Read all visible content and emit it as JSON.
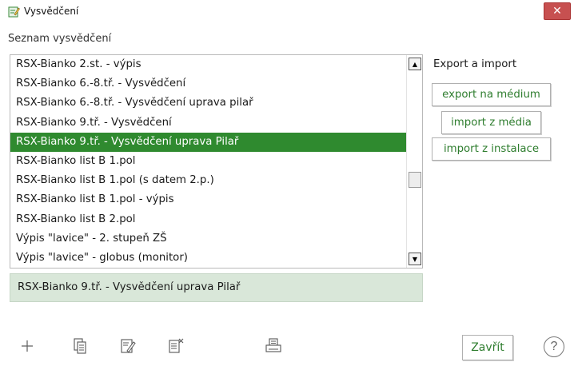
{
  "window": {
    "title": "Vysvědčení",
    "close_label": "✕"
  },
  "list": {
    "label": "Seznam vysvědčení",
    "items": [
      "RSX-Bianko 2.st. - výpis",
      "RSX-Bianko 6.-8.tř. - Vysvědčení",
      "RSX-Bianko 6.-8.tř. - Vysvědčení uprava pilař",
      "RSX-Bianko 9.tř. - Vysvědčení",
      "RSX-Bianko 9.tř. - Vysvědčení uprava Pilař",
      "RSX-Bianko list B 1.pol",
      "RSX-Bianko list B 1.pol (s datem 2.p.)",
      "RSX-Bianko list B 1.pol - výpis",
      "RSX-Bianko list B 2.pol",
      "Výpis \"lavice\" - 2. stupeň ZŠ",
      "Výpis \"lavice\" - globus (monitor)"
    ],
    "selected_index": 4,
    "selected_text": "RSX-Bianko 9.tř. - Vysvědčení uprava Pilař"
  },
  "export_import": {
    "label": "Export a import",
    "export_media": "export na médium",
    "import_media": "import z média",
    "import_install": "import z instalace"
  },
  "toolbar": {
    "icons": [
      "add-icon",
      "copy-icon",
      "edit-icon",
      "delete-icon",
      "print-icon"
    ]
  },
  "footer": {
    "close_label": "Zavřít",
    "help_label": "?"
  },
  "colors": {
    "selection": "#2f8a2f",
    "button_text": "#2e7d2e",
    "selected_display_bg": "#d9e7d9",
    "close_button": "#c75050"
  }
}
